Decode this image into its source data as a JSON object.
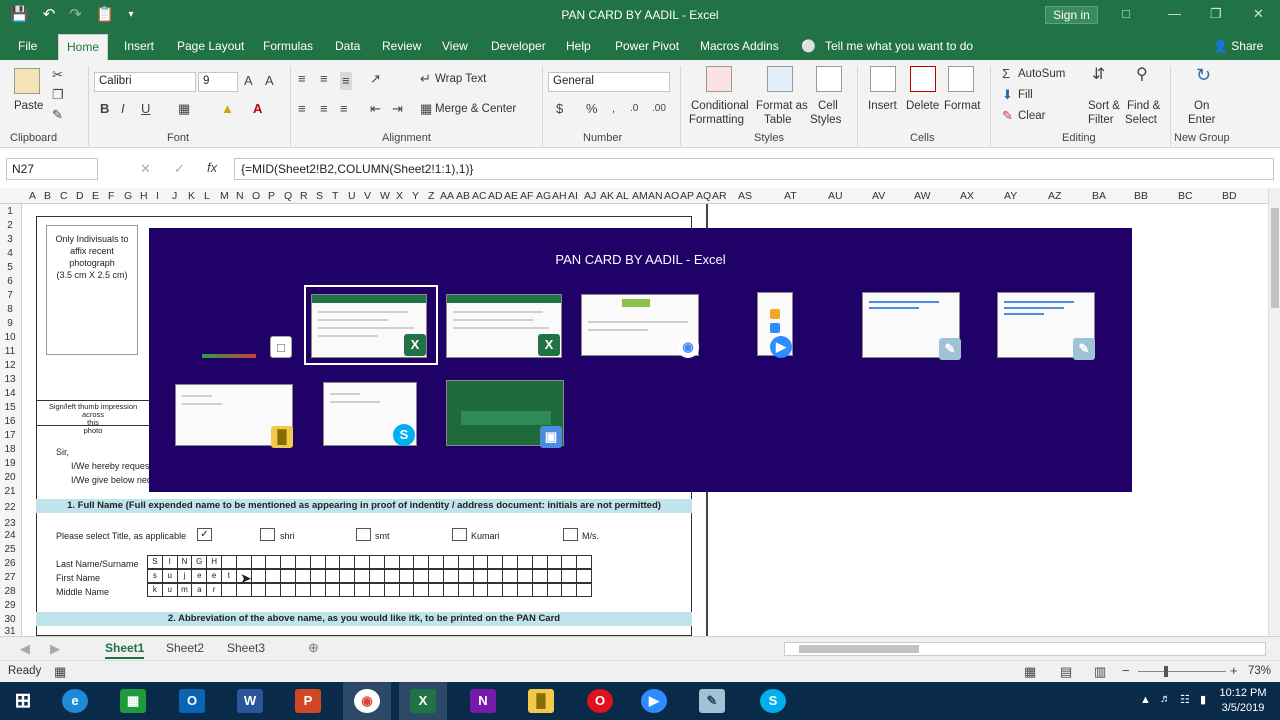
{
  "window": {
    "title": "PAN CARD BY AADIL  -  Excel",
    "sign_in": "Sign in",
    "share": "Share"
  },
  "menu_tabs": [
    "File",
    "Home",
    "Insert",
    "Page Layout",
    "Formulas",
    "Data",
    "Review",
    "View",
    "Developer",
    "Help",
    "Power Pivot",
    "Macros Addins",
    "Tell me what you want to do"
  ],
  "ribbon": {
    "clipboard": {
      "paste": "Paste",
      "label": "Clipboard"
    },
    "font": {
      "name": "Calibri",
      "size": "9",
      "label": "Font"
    },
    "alignment": {
      "wrap_text": "Wrap Text",
      "merge_center": "Merge & Center",
      "label": "Alignment"
    },
    "number": {
      "format": "General",
      "label": "Number"
    },
    "styles": {
      "conditional": "Conditional",
      "formatting": "Formatting",
      "format_as": "Format as",
      "table": "Table",
      "cell": "Cell",
      "cell_styles": "Styles",
      "label": "Styles"
    },
    "cells": {
      "insert": "Insert",
      "delete": "Delete",
      "format": "Format",
      "label": "Cells"
    },
    "editing": {
      "autosum": "AutoSum",
      "fill": "Fill",
      "clear": "Clear",
      "sort": "Sort &",
      "filter": "Filter",
      "find": "Find &",
      "select": "Select",
      "label": "Editing"
    },
    "new_group": {
      "on": "On",
      "enter": "Enter",
      "label": "New Group"
    }
  },
  "formula_bar": {
    "name_box": "N27",
    "formula": "{=MID(Sheet2!B2,COLUMN(Sheet2!1:1),1)}"
  },
  "column_headers_right": [
    "AS",
    "AT",
    "AU",
    "AV",
    "AW",
    "AX",
    "AY",
    "AZ",
    "BA",
    "BB",
    "BC",
    "BD"
  ],
  "row_numbers": [
    "1",
    "2",
    "3",
    "4",
    "5",
    "6",
    "7",
    "8",
    "9",
    "10",
    "11",
    "12",
    "13",
    "14",
    "15",
    "16",
    "17",
    "18",
    "19",
    "20",
    "21",
    "22",
    "23",
    "24",
    "25",
    "26",
    "27",
    "28",
    "29",
    "30",
    "31"
  ],
  "form": {
    "photo_text": [
      "Only Indivisuals to",
      "affix recent",
      "photograph",
      "(3.5 cm X 2.5 cm)"
    ],
    "sign_text": [
      "Sign/left thumb impression across",
      "this",
      "photo"
    ],
    "sir": "Sir,",
    "request1": "I/We hereby request",
    "request2": "I/We give below nece",
    "section1": "1. Full Name (Full expended name to be mentioned as appearing in proof of indentity / address document: initials are not permitted)",
    "title_prompt": "Please select Title, as applicable",
    "titles": [
      "shri",
      "smt",
      "Kumari",
      "M/s."
    ],
    "last_name_label": "Last Name/Surname",
    "first_name_label": "First Name",
    "middle_name_label": "Middle Name",
    "last_name": [
      "S",
      "I",
      "N",
      "G",
      "H"
    ],
    "first_name": [
      "s",
      "u",
      "j",
      "e",
      "e",
      "t"
    ],
    "middle_name": [
      "k",
      "u",
      "m",
      "a",
      "r"
    ],
    "section2": "2. Abbreviation of the above name, as you would like itk, to be printed on the PAN Card"
  },
  "switcher": {
    "title": "PAN CARD BY AADIL - Excel"
  },
  "sheets": [
    "Sheet1",
    "Sheet2",
    "Sheet3"
  ],
  "status": {
    "ready": "Ready",
    "zoom": "73%"
  },
  "taskbar": {
    "time": "10:12 PM",
    "date": "3/5/2019"
  }
}
